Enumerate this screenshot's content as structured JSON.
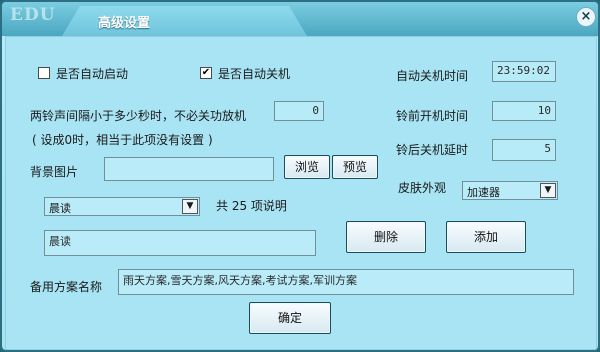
{
  "window": {
    "logo": "EDU",
    "title": "高级设置",
    "close_label": "×"
  },
  "auto_start": {
    "label": "是否自动启动",
    "checked": false
  },
  "auto_shutdown": {
    "label": "是否自动关机",
    "checked": true,
    "check_mark": "✔"
  },
  "shutdown_time": {
    "label": "自动关机时间",
    "value": "23:59:02"
  },
  "bell_interval": {
    "label": "两铃声间隔小于多少秒时，不必关功放机",
    "value": "0",
    "note": "( 设成0时，相当于此项没有设置 )"
  },
  "pre_bell_boot": {
    "label": "铃前开机时间",
    "value": "10"
  },
  "post_bell_shutdown": {
    "label": "铃后关机延时",
    "value": "5"
  },
  "background_image": {
    "label": "背景图片",
    "value": "",
    "browse": "浏览",
    "preview": "预览"
  },
  "skin": {
    "label": "皮肤外观",
    "selected": "加速器"
  },
  "plan_select": {
    "selected": "晨读",
    "count_text": "共 25 项说明"
  },
  "plan_name_input": {
    "value": "晨读"
  },
  "buttons": {
    "delete": "删除",
    "add": "添加",
    "ok": "确定"
  },
  "backup_plans": {
    "label": "备用方案名称",
    "value": "雨天方案,雪天方案,风天方案,考试方案,军训方案"
  },
  "icons": {
    "dropdown": "▼"
  }
}
